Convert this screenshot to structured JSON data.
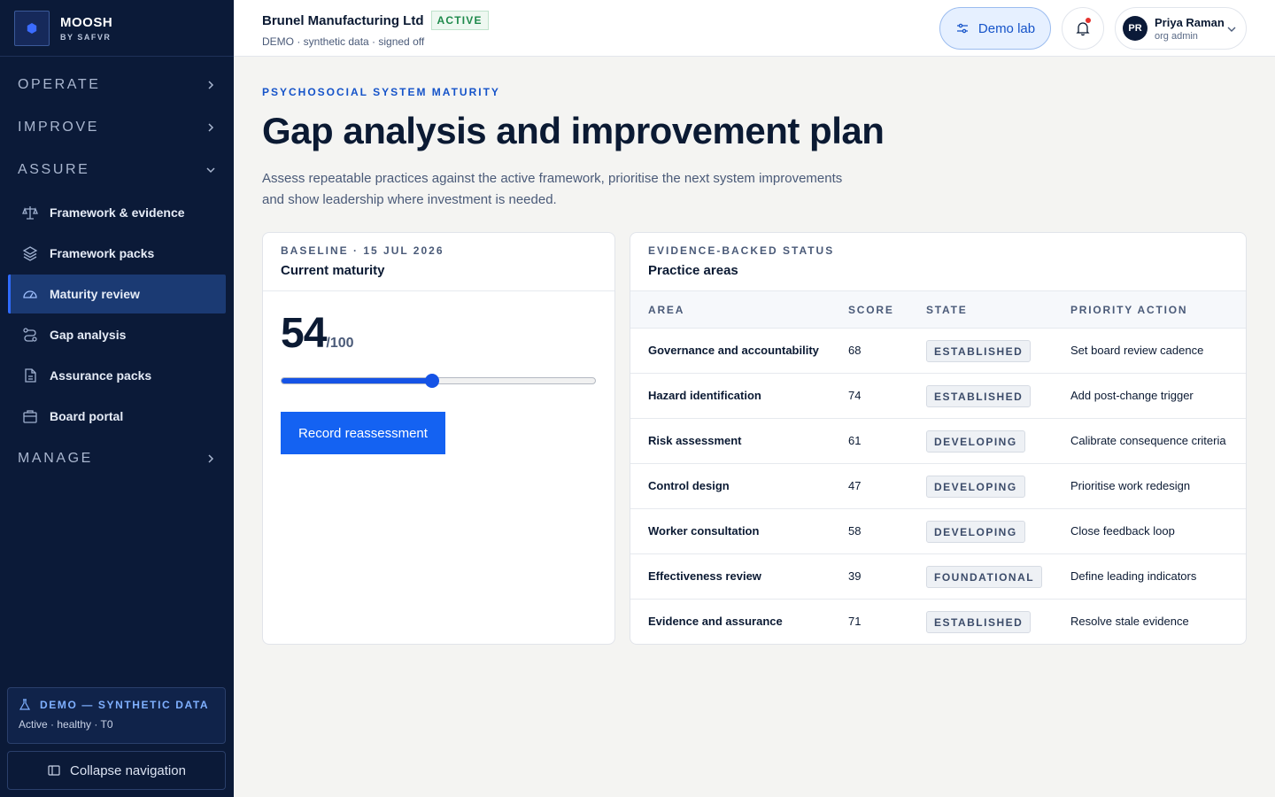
{
  "brand": {
    "name": "MOOSH",
    "sub": "BY SAFVR"
  },
  "nav": {
    "sections": [
      {
        "label": "OPERATE"
      },
      {
        "label": "IMPROVE"
      },
      {
        "label": "ASSURE"
      },
      {
        "label": "MANAGE"
      }
    ],
    "items": [
      {
        "label": "Framework & evidence",
        "icon": "scales-icon"
      },
      {
        "label": "Framework packs",
        "icon": "layers-icon"
      },
      {
        "label": "Maturity review",
        "icon": "gauge-icon",
        "active": true
      },
      {
        "label": "Gap analysis",
        "icon": "route-icon"
      },
      {
        "label": "Assurance packs",
        "icon": "document-icon"
      },
      {
        "label": "Board portal",
        "icon": "briefcase-icon"
      }
    ],
    "demo_title": "DEMO — SYNTHETIC DATA",
    "demo_status": "Active · healthy · T0",
    "collapse_label": "Collapse navigation"
  },
  "topbar": {
    "org_name": "Brunel Manufacturing Ltd",
    "org_status": "ACTIVE",
    "org_sub": "DEMO · synthetic data · signed off",
    "demo_lab": "Demo lab",
    "user_initials": "PR",
    "user_name": "Priya Raman",
    "user_role": "org admin"
  },
  "page": {
    "eyebrow": "PSYCHOSOCIAL SYSTEM MATURITY",
    "title": "Gap analysis and improvement plan",
    "description": "Assess repeatable practices against the active framework, prioritise the next system improvements and show leadership where investment is needed."
  },
  "maturity": {
    "eyebrow": "BASELINE · 15 JUL 2026",
    "title": "Current maturity",
    "score": "54",
    "max": "/100",
    "level_fraction": 0.48,
    "button": "Record reassessment"
  },
  "practice": {
    "eyebrow": "EVIDENCE-BACKED STATUS",
    "title": "Practice areas",
    "columns": [
      "AREA",
      "SCORE",
      "STATE",
      "PRIORITY ACTION"
    ],
    "rows": [
      {
        "area": "Governance and accountability",
        "score": "68",
        "state": "ESTABLISHED",
        "action": "Set board review cadence"
      },
      {
        "area": "Hazard identification",
        "score": "74",
        "state": "ESTABLISHED",
        "action": "Add post-change trigger"
      },
      {
        "area": "Risk assessment",
        "score": "61",
        "state": "DEVELOPING",
        "action": "Calibrate consequence criteria"
      },
      {
        "area": "Control design",
        "score": "47",
        "state": "DEVELOPING",
        "action": "Prioritise work redesign"
      },
      {
        "area": "Worker consultation",
        "score": "58",
        "state": "DEVELOPING",
        "action": "Close feedback loop"
      },
      {
        "area": "Effectiveness review",
        "score": "39",
        "state": "FOUNDATIONAL",
        "action": "Define leading indicators"
      },
      {
        "area": "Evidence and assurance",
        "score": "71",
        "state": "ESTABLISHED",
        "action": "Resolve stale evidence"
      }
    ]
  },
  "colors": {
    "sidebar": "#0b1a38",
    "accent": "#1462f2",
    "active_nav": "#1b3a73",
    "success": "#1f8a4c"
  }
}
